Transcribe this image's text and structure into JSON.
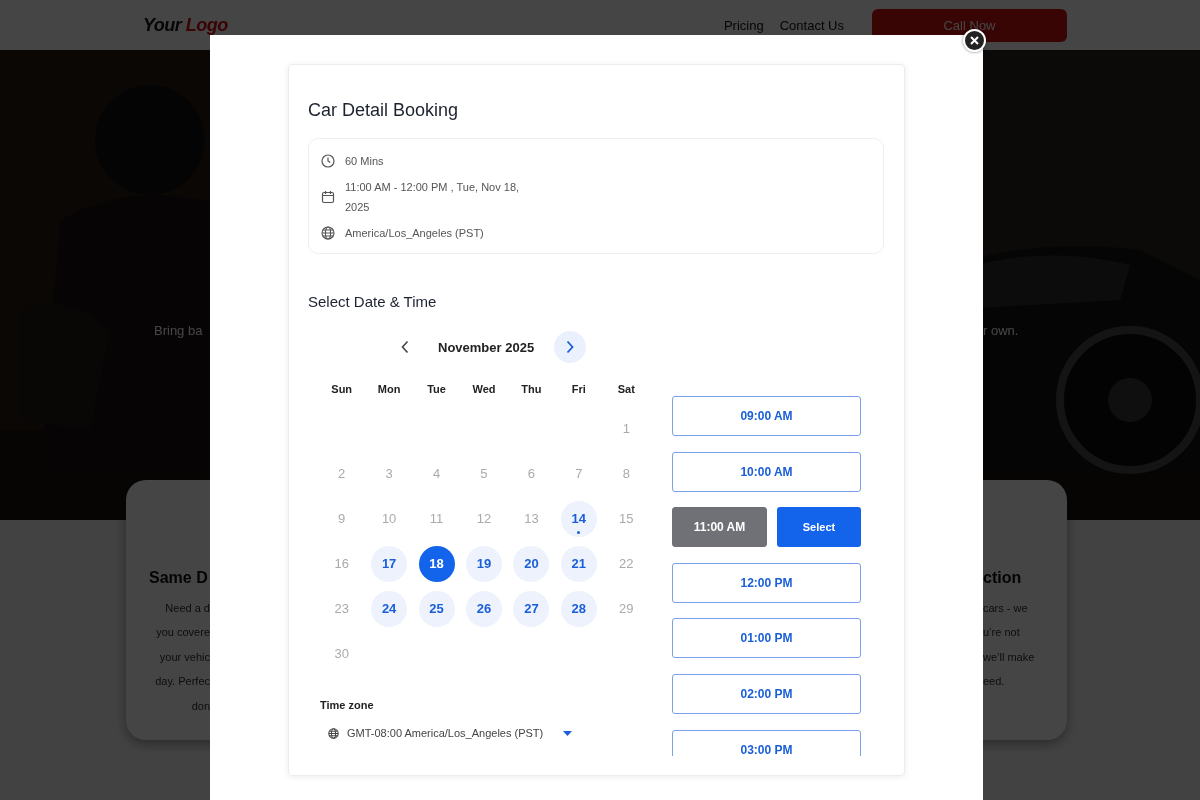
{
  "header": {
    "logo": [
      "Your",
      "Logo"
    ],
    "nav": [
      "Pricing",
      "Contact Us"
    ],
    "cta": "Call Now"
  },
  "hero": {
    "kind": "picture",
    "left_text": "Bring ba",
    "right_text": "r own."
  },
  "features": [
    {
      "title": "Same D",
      "lines": [
        "Need a d",
        "you covere",
        "your vehic",
        "day. Perfec",
        "don"
      ]
    },
    {
      "title": "ction",
      "lines": [
        "cars - we",
        "u’re not",
        "we’ll make",
        "eed."
      ]
    }
  ],
  "modal": {
    "title": "Car Detail Booking",
    "details": [
      {
        "kind": "duration",
        "text": "60 Mins"
      },
      {
        "kind": "date",
        "text": "11:00 AM - 12:00 PM , Tue, Nov 18, 2025"
      },
      {
        "kind": "timezone",
        "text": "America/Los_Angeles (PST)"
      }
    ],
    "section_title": "Select Date & Time",
    "calendar": {
      "month": "November 2025",
      "weekdays": [
        "Sun",
        "Mon",
        "Tue",
        "Wed",
        "Thu",
        "Fri",
        "Sat"
      ],
      "weeks": [
        [
          {
            "day": "1",
            "available": false,
            "selected": false,
            "today": false
          }
        ],
        [
          {
            "day": "2",
            "available": false,
            "selected": false,
            "today": false
          },
          {
            "day": "3",
            "available": false,
            "selected": false,
            "today": false
          },
          {
            "day": "4",
            "available": false,
            "selected": false,
            "today": false
          },
          {
            "day": "5",
            "available": false,
            "selected": false,
            "today": false
          },
          {
            "day": "6",
            "available": false,
            "selected": false,
            "today": false
          },
          {
            "day": "7",
            "available": false,
            "selected": false,
            "today": false
          },
          {
            "day": "8",
            "available": false,
            "selected": false,
            "today": false
          }
        ],
        [
          {
            "day": "9",
            "available": false,
            "selected": false,
            "today": false
          },
          {
            "day": "10",
            "available": false,
            "selected": false,
            "today": false
          },
          {
            "day": "11",
            "available": false,
            "selected": false,
            "today": false
          },
          {
            "day": "12",
            "available": false,
            "selected": false,
            "today": false
          },
          {
            "day": "13",
            "available": false,
            "selected": false,
            "today": false
          },
          {
            "day": "14",
            "available": true,
            "selected": false,
            "today": true
          },
          {
            "day": "15",
            "available": false,
            "selected": false,
            "today": false
          }
        ],
        [
          {
            "day": "16",
            "available": false,
            "selected": false,
            "today": false
          },
          {
            "day": "17",
            "available": true,
            "selected": false,
            "today": false
          },
          {
            "day": "18",
            "available": true,
            "selected": true,
            "today": false
          },
          {
            "day": "19",
            "available": true,
            "selected": false,
            "today": false
          },
          {
            "day": "20",
            "available": true,
            "selected": false,
            "today": false
          },
          {
            "day": "21",
            "available": true,
            "selected": false,
            "today": false
          },
          {
            "day": "22",
            "available": false,
            "selected": false,
            "today": false
          }
        ],
        [
          {
            "day": "23",
            "available": false,
            "selected": false,
            "today": false
          },
          {
            "day": "24",
            "available": true,
            "selected": false,
            "today": false
          },
          {
            "day": "25",
            "available": true,
            "selected": false,
            "today": false
          },
          {
            "day": "26",
            "available": true,
            "selected": false,
            "today": false
          },
          {
            "day": "27",
            "available": true,
            "selected": false,
            "today": false
          },
          {
            "day": "28",
            "available": true,
            "selected": false,
            "today": false
          },
          {
            "day": "29",
            "available": false,
            "selected": false,
            "today": false
          }
        ],
        [
          {
            "day": "30",
            "available": false,
            "selected": false,
            "today": false
          }
        ]
      ]
    },
    "timezone": {
      "label": "Time zone",
      "value": "GMT-08:00 America/Los_Angeles (PST)"
    },
    "slots": [
      {
        "time": "09:00 AM",
        "selected": false
      },
      {
        "time": "10:00 AM",
        "selected": false
      },
      {
        "time": "11:00 AM",
        "selected": true,
        "action": "Select"
      },
      {
        "time": "12:00 PM",
        "selected": false
      },
      {
        "time": "01:00 PM",
        "selected": false
      },
      {
        "time": "02:00 PM",
        "selected": false
      },
      {
        "time": "03:00 PM",
        "selected": false
      }
    ]
  }
}
